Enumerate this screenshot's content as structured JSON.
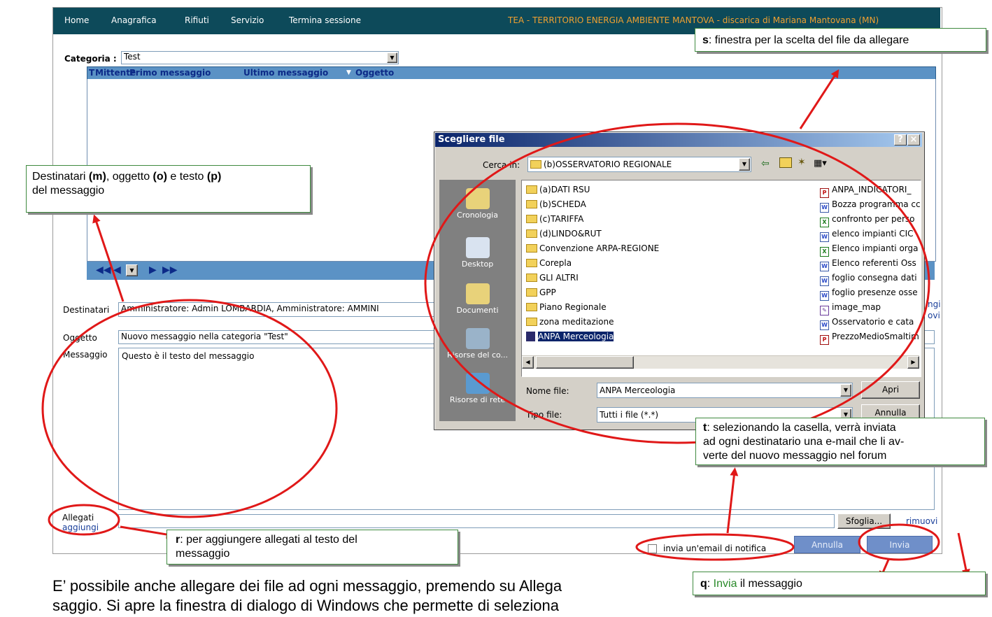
{
  "nav": {
    "items": [
      "Home",
      "Anagrafica",
      "Rifiuti",
      "Servizio",
      "Termina sessione"
    ],
    "title": "TEA - TERRITORIO ENERGIA AMBIENTE MANTOVA - discarica di Mariana Mantovana (MN)"
  },
  "category": {
    "label": "Categoria :",
    "value": "Test"
  },
  "grid": {
    "columns": [
      "T",
      "Mittente",
      "Primo messaggio",
      "Ultimo messaggio",
      "Oggetto"
    ],
    "pager": [
      "◀◀",
      "◀",
      "▶",
      "▶▶"
    ]
  },
  "form": {
    "recipients_label": "Destinatari",
    "recipients_value": "Amministratore: Admin LOMBARDIA, Amministratore: AMMINI",
    "right_links": [
      "ngi",
      "ovi"
    ],
    "subject_label": "Oggetto",
    "subject_value": "Nuovo messaggio nella categoria \"Test\"",
    "message_label": "Messaggio",
    "message_value": "Questo è il testo del messaggio",
    "attachments_label": "Allegati",
    "attachments_add": "aggiungi",
    "browse_button": "Sfoglia...",
    "remove_link": "rimuovi",
    "notify_label": "invia un'email di notifica",
    "cancel_button": "Annulla",
    "send_button": "Invia"
  },
  "dialog": {
    "title": "Scegliere file",
    "help": "?",
    "close": "×",
    "look_in_label": "Cerca in:",
    "look_in_value": "(b)OSSERVATORIO REGIONALE",
    "places": [
      "Cronologia",
      "Desktop",
      "Documenti",
      "Risorse del co...",
      "Risorse di rete"
    ],
    "folders": [
      "(a)DATI RSU",
      "(b)SCHEDA",
      "(c)TARIFFA",
      "(d)LINDO&RUT",
      "Convenzione ARPA-REGIONE",
      "Corepla",
      "GLI ALTRI",
      "GPP",
      "Piano Regionale",
      "zona meditazione",
      "ANPA Merceologia"
    ],
    "files": [
      "ANPA_INDICATORI_",
      "Bozza programma cc",
      "confronto per perso",
      "elenco impianti CIC",
      "Elenco impianti orga",
      "Elenco referenti Oss",
      "foglio consegna dati",
      "foglio presenze osse",
      "image_map",
      "Osservatorio e cata",
      "PrezzoMedioSmaltim"
    ],
    "filename_label": "Nome file:",
    "filename_value": "ANPA Merceologia",
    "filetype_label": "Tipo file:",
    "filetype_value": "Tutti i file (*.*)",
    "open_button": "Apri",
    "cancel_button": "Annulla"
  },
  "callouts": {
    "s": {
      "key": "s",
      "text": ": finestra per la scelta del file da allegare"
    },
    "m": {
      "t1": "Destinatari ",
      "b1": "(m)",
      "t2": ", oggetto ",
      "b2": "(o)",
      "t3": " e testo ",
      "b3": "(p)",
      "t4": "del messaggio"
    },
    "t": {
      "key": "t",
      "line1": ": selezionando la casella, verrà inviata",
      "line2": "ad ogni destinatario una e-mail che li av-",
      "line3": "verte del nuovo messaggio nel forum"
    },
    "r": {
      "key": "r",
      "line1": ": per aggiungere allegati al testo del",
      "line2": "messaggio"
    },
    "q": {
      "key": "q",
      "colon": ": ",
      "action": "Invia",
      "rest": " il messaggio"
    }
  },
  "body_text": {
    "line1": "E’ possibile anche allegare dei file ad ogni messaggio, premendo su Allega",
    "line2": "saggio. Si apre la finestra di dialogo di Windows che permette di seleziona"
  },
  "colors": {
    "nav_bg": "#0d4a5a",
    "grid_blue": "#5b92c5",
    "ellipse_red": "#e01818",
    "callout_border": "#3f8a3f",
    "send_green": "#2a8a2a"
  }
}
